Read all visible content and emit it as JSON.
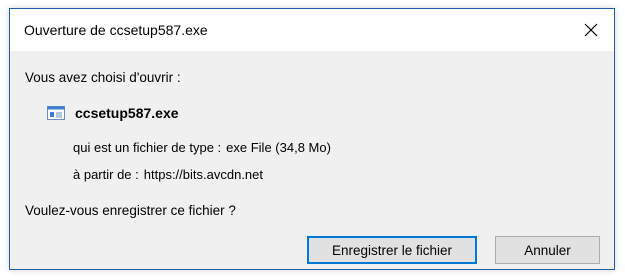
{
  "dialog": {
    "title": "Ouverture de ccsetup587.exe",
    "prompt": "Vous avez choisi d'ouvrir :",
    "file": {
      "name": "ccsetup587.exe",
      "icon": "exe-file-icon"
    },
    "type_label": "qui est un fichier de type :",
    "type_value": "exe File (34,8 Mo)",
    "source_label": "à partir de :",
    "source_value": "https://bits.avcdn.net",
    "question": "Voulez-vous enregistrer ce fichier ?",
    "buttons": {
      "save": "Enregistrer le fichier",
      "cancel": "Annuler"
    },
    "close_icon": "close-icon"
  },
  "colors": {
    "accent": "#0078d7",
    "border": "#1f5fa8",
    "content_bg": "#f0f0f0"
  }
}
